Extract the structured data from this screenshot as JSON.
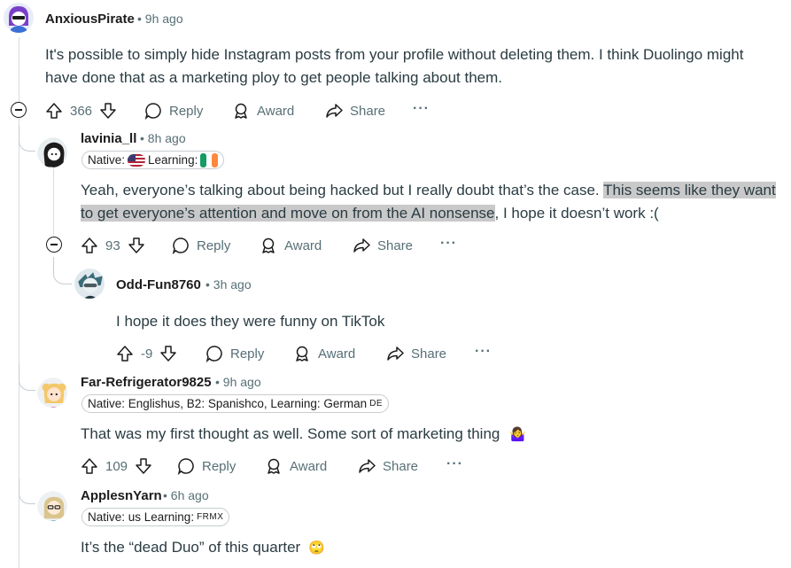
{
  "comments": [
    {
      "username": "AnxiousPirate",
      "time": "9h ago",
      "body_line1": "It's possible to simply hide Instagram posts from your profile without deleting them. I think Duolingo might",
      "body_line2": "have done that as a marketing ploy to get people talking about them.",
      "votes": "366",
      "reply": "Reply",
      "award": "Award",
      "share": "Share",
      "more": "···"
    },
    {
      "username": "lavinia_ll",
      "time": "8h ago",
      "flair_native": "Native:",
      "flair_learning": "Learning:",
      "body_line1_a": "Yeah, everyone’s talking about being hacked but I really doubt that’s the case. ",
      "body_line1_b": "This seems like they want",
      "body_line2_a": "to get everyone’s attention and move on from the AI nonsense",
      "body_line2_b": ", I hope it doesn’t work :(",
      "votes": "93",
      "reply": "Reply",
      "award": "Award",
      "share": "Share",
      "more": "···"
    },
    {
      "username": "Odd-Fun8760",
      "time": "3h ago",
      "body": "I hope it does they were funny on TikTok",
      "votes": "-9",
      "reply": "Reply",
      "award": "Award",
      "share": "Share",
      "more": "···"
    },
    {
      "username": "Far-Refrigerator9825",
      "time": "9h ago",
      "flair": "Native: Englishus, B2: Spanishco, Learning: German",
      "flair_suffix": "DE",
      "body": "That was my first thought as well. Some sort of marketing thing",
      "emoji": "🤷‍♀️",
      "votes": "109",
      "reply": "Reply",
      "award": "Award",
      "share": "Share",
      "more": "···"
    },
    {
      "username": "ApplesnYarn",
      "time": "6h ago",
      "flair": "Native: us Learning:",
      "flair_suffix": "FRMX",
      "body": "It’s the “dead Duo” of this quarter",
      "emoji": "🙄"
    }
  ],
  "colors": {
    "text": "#2a3c42",
    "meta": "#576f76",
    "thread": "#c7cdd1",
    "highlight": "#c9c9c9"
  }
}
